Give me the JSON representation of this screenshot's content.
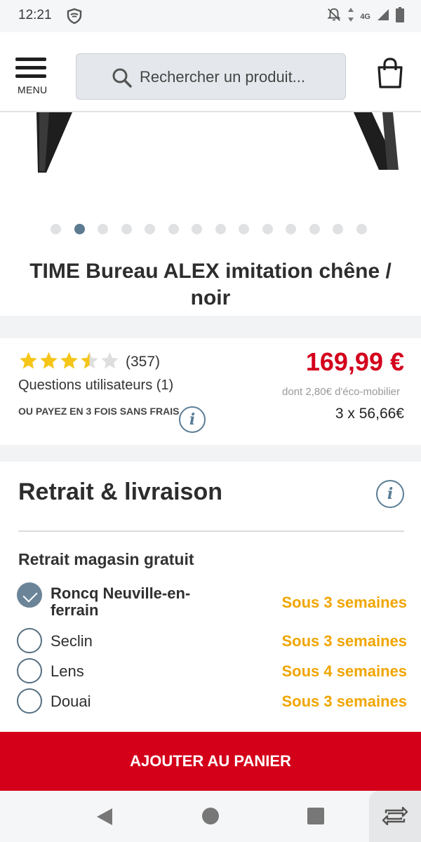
{
  "status_bar": {
    "time": "12:21",
    "network": "4G",
    "icons": [
      "shield-icon",
      "notifications-off-icon",
      "data-arrows-icon",
      "signal-icon",
      "battery-icon"
    ]
  },
  "header": {
    "menu_label": "MENU",
    "search_placeholder": "Rechercher un produit...",
    "icons": [
      "menu-icon",
      "search-icon",
      "shopping-bag-icon"
    ]
  },
  "gallery": {
    "total_images": 14,
    "active_index": 1
  },
  "product": {
    "title": "TIME Bureau ALEX imitation chêne / noir",
    "rating": 3.5,
    "rating_max": 5,
    "review_count": "(357)",
    "questions": "Questions utilisateurs (1)",
    "installments_note": "OU PAYEZ EN 3 FOIS SANS FRAIS",
    "price": "169,99 €",
    "eco_fee": "dont 2,80€ d'éco-mobilier",
    "installment_amount": "3 x 56,66€"
  },
  "delivery": {
    "title": "Retrait & livraison",
    "subtitle": "Retrait magasin gratuit",
    "stores": [
      {
        "name": "Roncq Neuville-en-ferrain",
        "delay": "Sous 3 semaines",
        "selected": true
      },
      {
        "name": "Seclin",
        "delay": "Sous 3 semaines",
        "selected": false
      },
      {
        "name": "Lens",
        "delay": "Sous 4 semaines",
        "selected": false
      },
      {
        "name": "Douai",
        "delay": "Sous 3 semaines",
        "selected": false
      }
    ]
  },
  "cta": {
    "add_to_cart": "AJOUTER AU PANIER"
  },
  "colors": {
    "price_red": "#d3001c",
    "cta_red": "#d4001a",
    "delay_orange": "#f0a500",
    "accent_slate": "#5b7d95",
    "star_gold": "#f5c518"
  }
}
